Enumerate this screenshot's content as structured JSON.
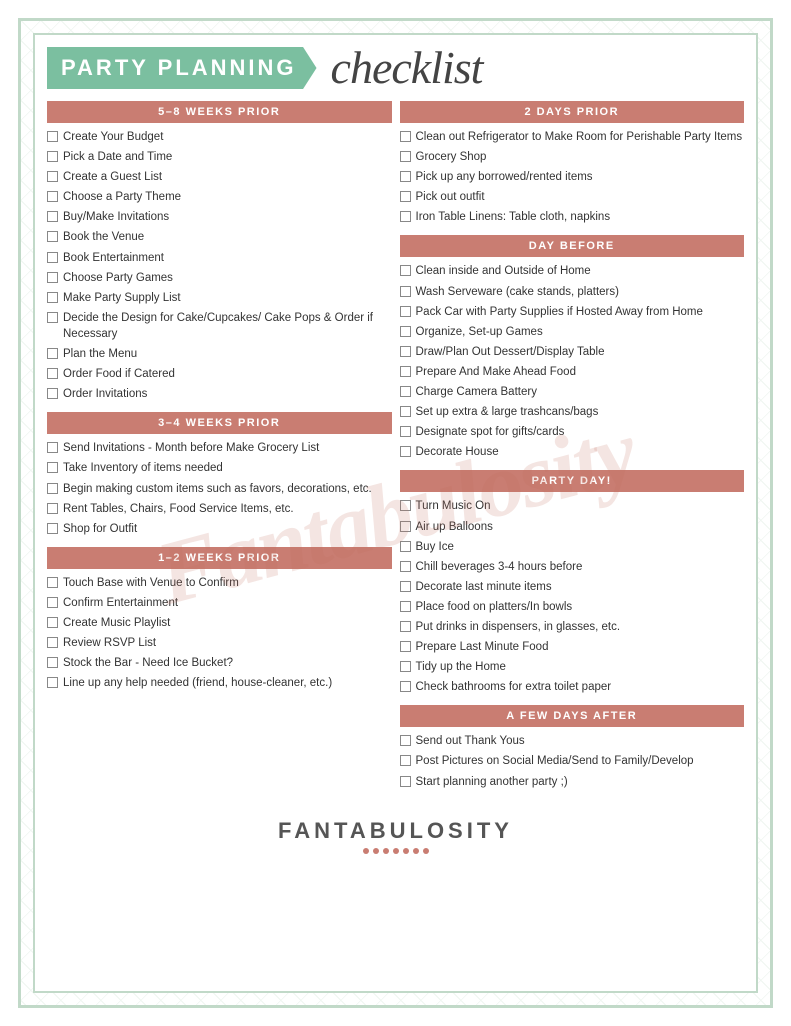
{
  "header": {
    "banner_text": "PARTY PLANNING",
    "checklist_text": "checklist",
    "brand": "FANTABULOSITY"
  },
  "watermark": "Fantabulosity",
  "sections": {
    "left": [
      {
        "title": "5–8 WEEKS PRIOR",
        "items": [
          "Create Your Budget",
          "Pick a Date and Time",
          "Create a Guest List",
          "Choose a Party Theme",
          "Buy/Make Invitations",
          "Book the Venue",
          "Book Entertainment",
          "Choose Party Games",
          "Make Party Supply List",
          "Decide the Design for Cake/Cupcakes/ Cake Pops & Order if Necessary",
          "Plan the Menu",
          "Order Food if Catered",
          "Order Invitations"
        ]
      },
      {
        "title": "3–4 WEEKS PRIOR",
        "items": [
          "Send Invitations - Month before Make Grocery List",
          "Take Inventory of items needed",
          "Begin making custom items such as favors, decorations, etc.",
          "Rent Tables, Chairs, Food Service Items, etc.",
          "Shop for Outfit"
        ]
      },
      {
        "title": "1–2 WEEKS PRIOR",
        "items": [
          "Touch Base with Venue to Confirm",
          "Confirm Entertainment",
          "Create Music Playlist",
          "Review RSVP List",
          "Stock the Bar - Need Ice Bucket?",
          "Line up any help needed (friend, house-cleaner, etc.)"
        ]
      }
    ],
    "right": [
      {
        "title": "2 DAYS PRIOR",
        "items": [
          "Clean out Refrigerator to Make Room for Perishable Party Items",
          "Grocery Shop",
          "Pick up any borrowed/rented items",
          "Pick out outfit",
          "Iron Table Linens: Table cloth, napkins"
        ]
      },
      {
        "title": "DAY BEFORE",
        "items": [
          "Clean inside and Outside of Home",
          "Wash Serveware (cake stands, platters)",
          "Pack Car with Party Supplies if Hosted Away from Home",
          "Organize, Set-up Games",
          "Draw/Plan Out Dessert/Display Table",
          "Prepare And Make Ahead Food",
          "Charge Camera Battery",
          "Set up extra & large trashcans/bags",
          "Designate spot for gifts/cards",
          "Decorate House"
        ]
      },
      {
        "title": "PARTY DAY!",
        "items": [
          "Turn Music On",
          "Air up Balloons",
          "Buy Ice",
          "Chill beverages 3-4 hours before",
          "Decorate last minute items",
          "Place food on platters/In bowls",
          "Put drinks in dispensers, in glasses, etc.",
          "Prepare Last Minute Food",
          "Tidy up the Home",
          "Check bathrooms for extra toilet paper"
        ]
      },
      {
        "title": "A FEW DAYS AFTER",
        "items": [
          "Send out Thank Yous",
          "Post Pictures on Social Media/Send to Family/Develop",
          "Start planning another party ;)"
        ]
      }
    ]
  }
}
